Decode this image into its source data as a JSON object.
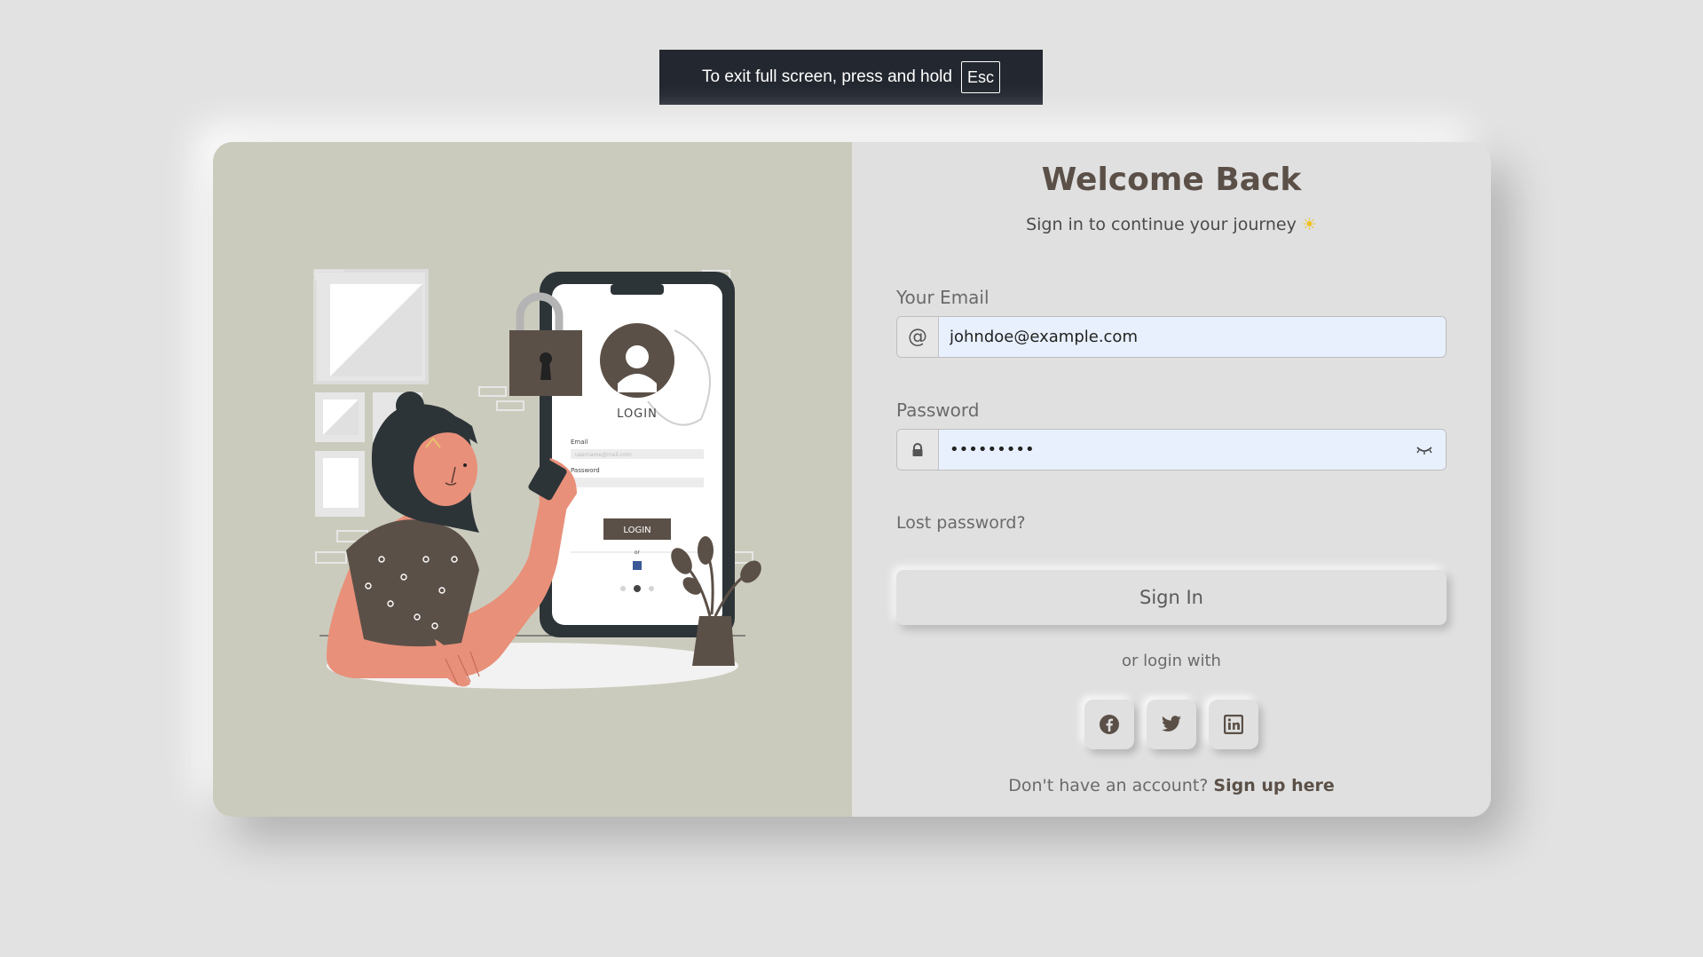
{
  "fullscreen_banner": {
    "message": "To exit full screen, press and hold",
    "key": "Esc"
  },
  "login": {
    "title": "Welcome Back",
    "subtitle": "Sign in to continue your journey",
    "subtitle_emoji": "☀",
    "email": {
      "label": "Your Email",
      "value": "johndoe@example.com",
      "icon": "at-icon"
    },
    "password": {
      "label": "Password",
      "value": "•••••••••",
      "icon": "lock-icon",
      "toggle_icon": "eye-closed-icon"
    },
    "lost_password": "Lost password?",
    "sign_in": "Sign In",
    "or_login_with": "or login with",
    "social": [
      "facebook-icon",
      "twitter-icon",
      "linkedin-icon"
    ],
    "no_account": "Don't have an account?",
    "sign_up": "Sign up here"
  },
  "illustration": {
    "phone_login_title": "LOGIN",
    "phone_email_label": "Email",
    "phone_email_placeholder": "username@mail.com",
    "phone_password_label": "Password",
    "phone_login_button": "LOGIN",
    "phone_or": "or"
  },
  "colors": {
    "page_bg": "#e2e2e2",
    "left_panel": "#cbcbbd",
    "right_panel": "#e0e0e0",
    "brand_brown": "#5b5048",
    "skin": "#e8907a",
    "input_fill": "#e8f0fe"
  }
}
